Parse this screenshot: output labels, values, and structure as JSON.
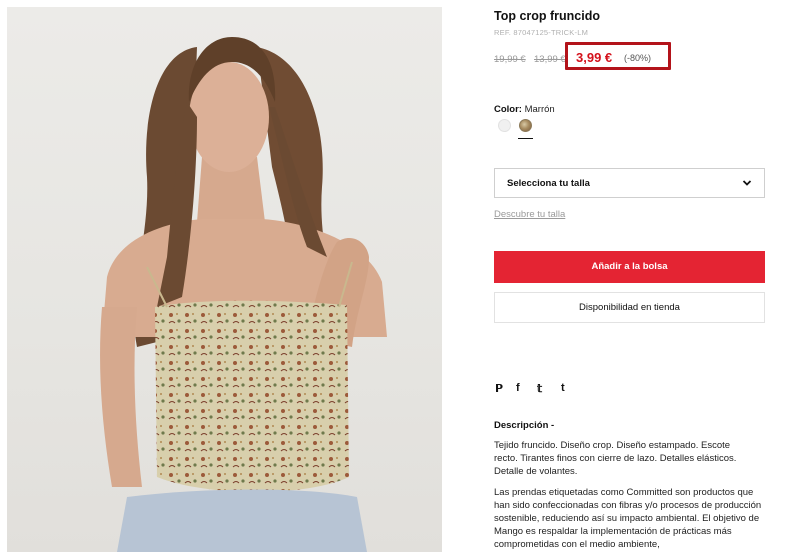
{
  "product": {
    "title": "Top crop fruncido",
    "ref": "REF. 87047125-TRICK-LM",
    "price_original": "19,99 €",
    "price_previous": "13,99 €",
    "price_current": "3,99 €",
    "discount": "(-80%)",
    "highlight_color": "#b3131a",
    "price_color": "#d4111b"
  },
  "color": {
    "label": "Color:",
    "value": "Marrón",
    "swatches": [
      "white-swatch",
      "brown-print-swatch"
    ],
    "selected": "brown-print-swatch"
  },
  "size": {
    "select_label": "Selecciona tu talla",
    "discover_link": "Descubre tu talla"
  },
  "actions": {
    "add_to_bag": "Añadir a la bolsa",
    "add_to_bag_color": "#e42433",
    "store_availability": "Disponibilidad en tienda"
  },
  "social": {
    "icons": [
      "pinterest-icon",
      "facebook-icon",
      "twitter-icon",
      "tumblr-icon"
    ],
    "glyphs": [
      "𝗣",
      "f",
      "𝕥",
      "t"
    ]
  },
  "description": {
    "title": "Descripción -",
    "paragraph1": "Tejido fruncido. Diseño crop. Diseño estampado. Escote recto. Tirantes finos con cierre de lazo. Detalles elásticos. Detalle de volantes.",
    "paragraph2": "Las prendas etiquetadas como Committed son productos que han sido confeccionadas con fibras y/o procesos de producción sostenible, reduciendo así su impacto ambiental. El objetivo de Mango es respaldar la implementación de prácticas más comprometidas con el medio ambiente,"
  }
}
